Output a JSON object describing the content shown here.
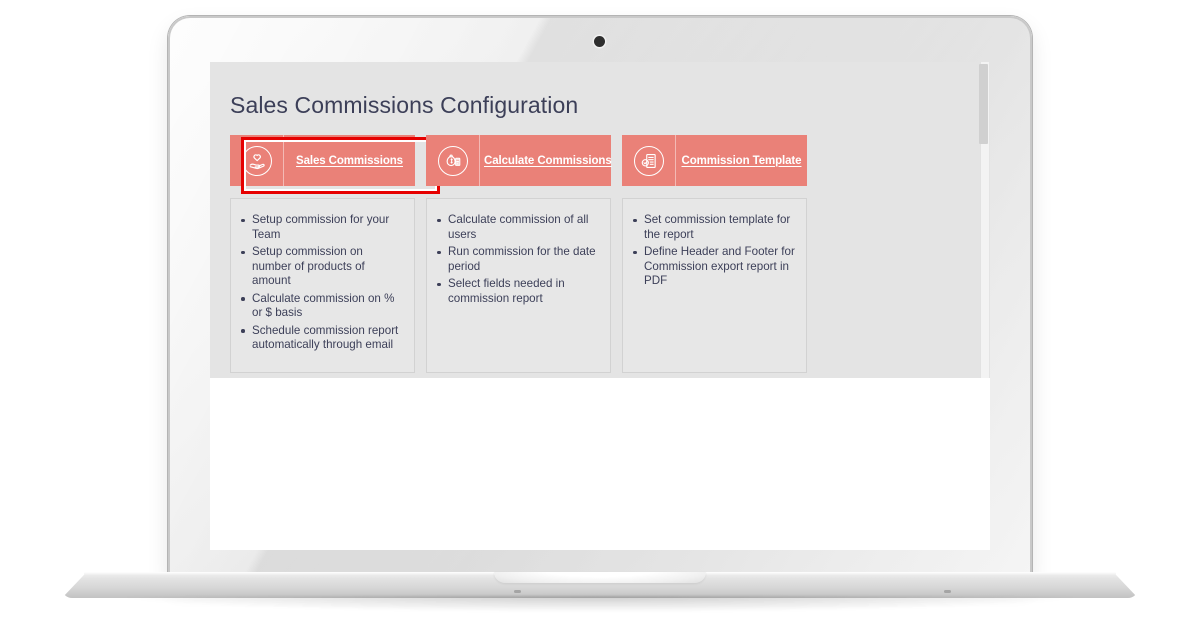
{
  "device": {
    "type": "laptop-mockup",
    "webcam": "webcam-dot"
  },
  "page": {
    "title": "Sales Commissions Configuration",
    "background_color": "#e4e4e4",
    "accent_color": "#ea8178",
    "text_color": "#3c3f58",
    "highlight_color": "#e60000"
  },
  "tabs": [
    {
      "label": "Sales Commissions",
      "icon": "hand-holding-heart-icon",
      "highlighted": true
    },
    {
      "label": "Calculate Commissions",
      "icon": "money-bag-calculator-icon",
      "highlighted": false
    },
    {
      "label": "Commission Template",
      "icon": "document-template-icon",
      "highlighted": false
    }
  ],
  "cards": [
    {
      "items": [
        "Setup commission for your Team",
        "Setup commission on number of products of amount",
        "Calculate commission on % or $ basis",
        "Schedule commission report automatically through email"
      ]
    },
    {
      "items": [
        "Calculate commission of all users",
        "Run commission for the date period",
        "Select fields needed in commission report"
      ]
    },
    {
      "items": [
        "Set commission template for the report",
        "Define Header and Footer for Commission export report in PDF"
      ]
    }
  ]
}
